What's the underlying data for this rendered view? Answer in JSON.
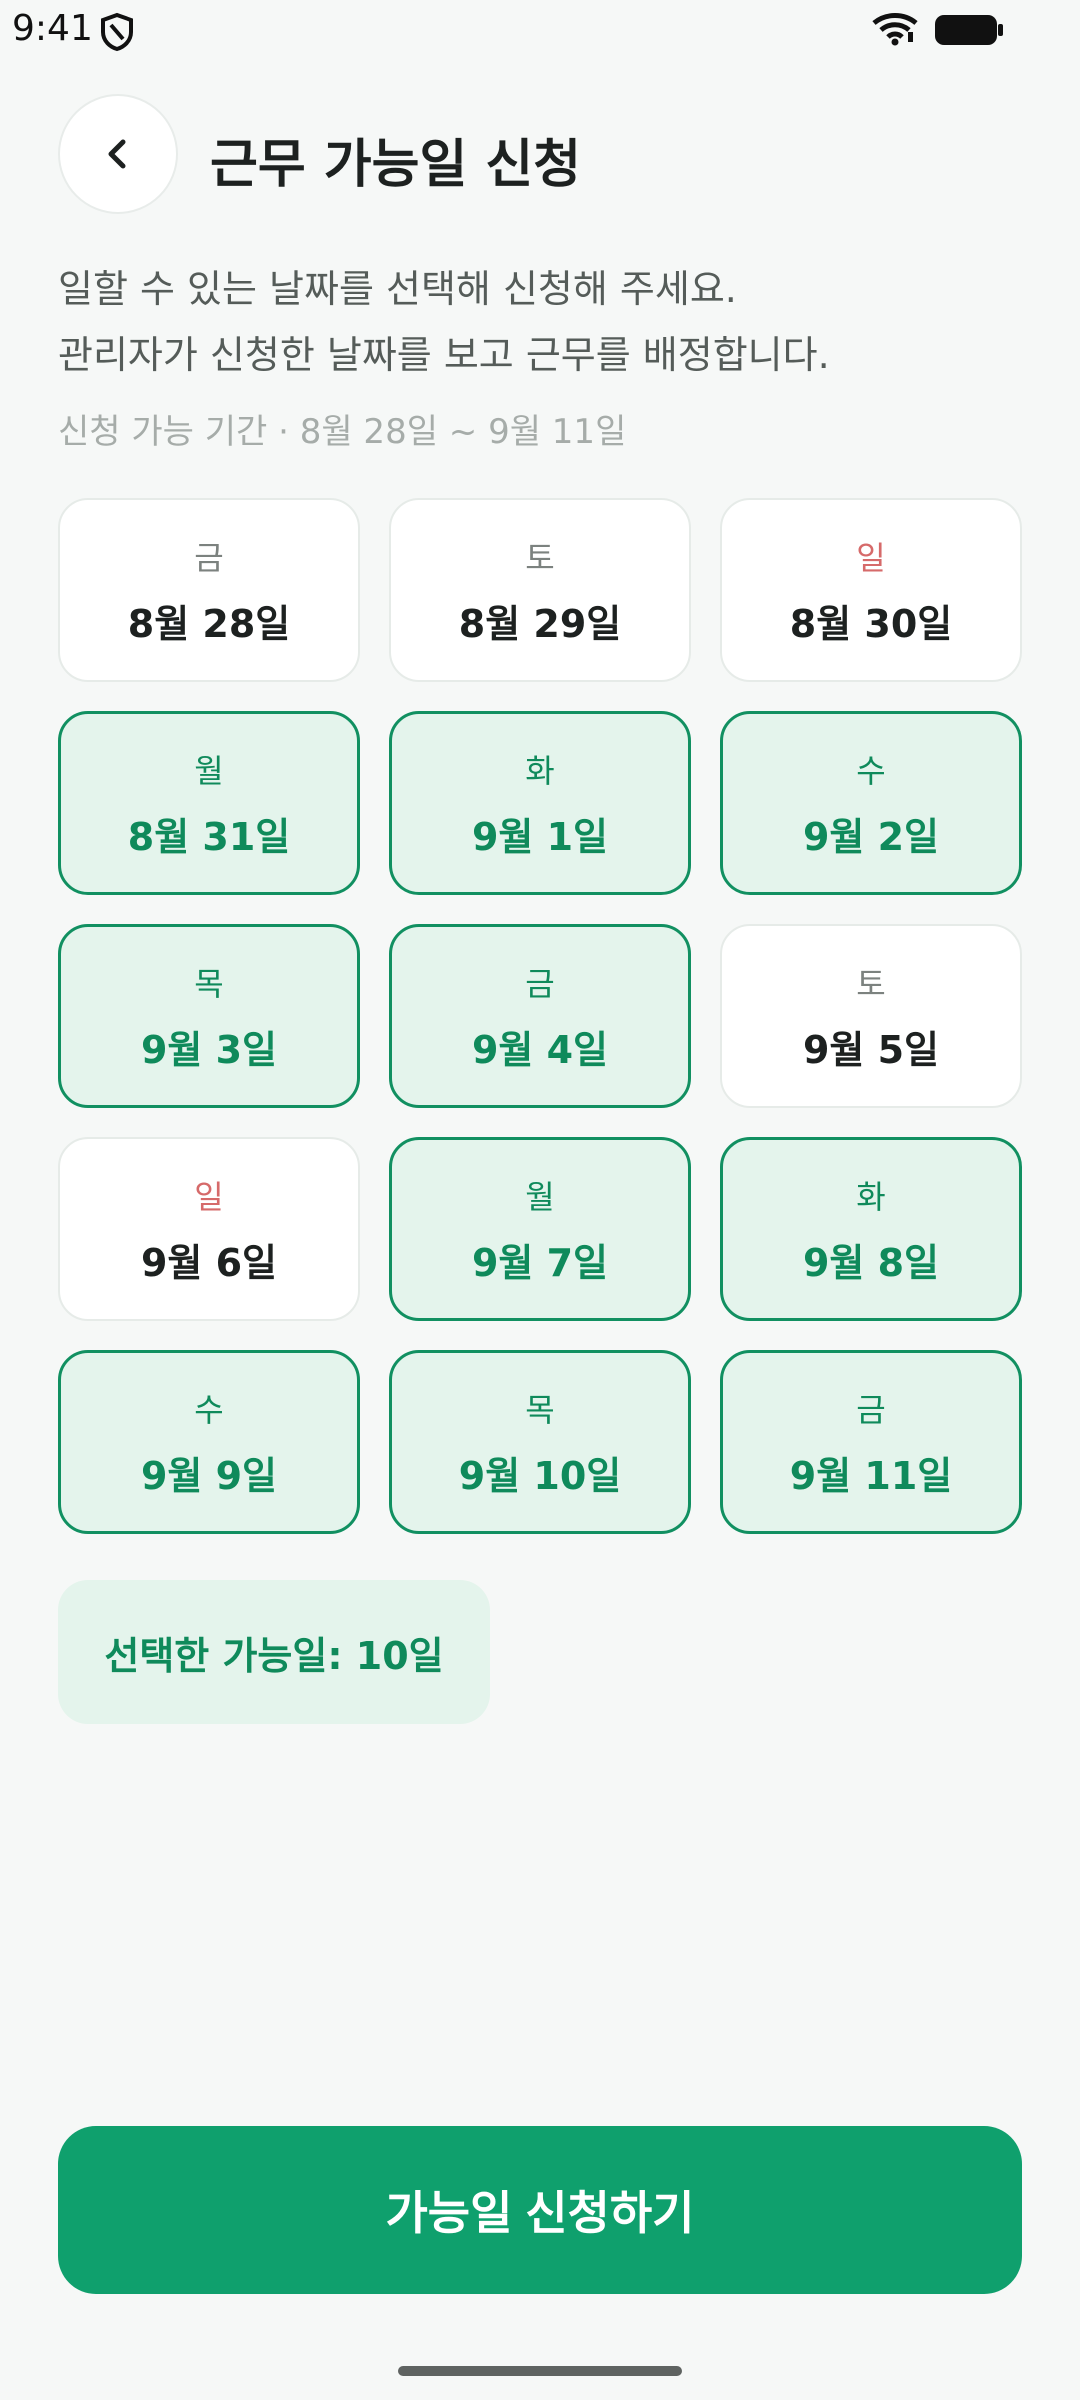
{
  "status_bar": {
    "time": "9:41"
  },
  "header": {
    "title": "근무 가능일 신청"
  },
  "description": {
    "line1": "일할 수 있는 날짜를 선택해 신청해 주세요.",
    "line2": "관리자가 신청한 날짜를 보고 근무를 배정합니다."
  },
  "period_label": "신청 가능 기간 · 8월 28일 ~ 9월 11일",
  "days": [
    {
      "weekday": "금",
      "date": "8월 28일",
      "selected": false,
      "sunday": false
    },
    {
      "weekday": "토",
      "date": "8월 29일",
      "selected": false,
      "sunday": false
    },
    {
      "weekday": "일",
      "date": "8월 30일",
      "selected": false,
      "sunday": true
    },
    {
      "weekday": "월",
      "date": "8월 31일",
      "selected": true,
      "sunday": false
    },
    {
      "weekday": "화",
      "date": "9월 1일",
      "selected": true,
      "sunday": false
    },
    {
      "weekday": "수",
      "date": "9월 2일",
      "selected": true,
      "sunday": false
    },
    {
      "weekday": "목",
      "date": "9월 3일",
      "selected": true,
      "sunday": false
    },
    {
      "weekday": "금",
      "date": "9월 4일",
      "selected": true,
      "sunday": false
    },
    {
      "weekday": "토",
      "date": "9월 5일",
      "selected": false,
      "sunday": false
    },
    {
      "weekday": "일",
      "date": "9월 6일",
      "selected": false,
      "sunday": true
    },
    {
      "weekday": "월",
      "date": "9월 7일",
      "selected": true,
      "sunday": false
    },
    {
      "weekday": "화",
      "date": "9월 8일",
      "selected": true,
      "sunday": false
    },
    {
      "weekday": "수",
      "date": "9월 9일",
      "selected": true,
      "sunday": false
    },
    {
      "weekday": "목",
      "date": "9월 10일",
      "selected": true,
      "sunday": false
    },
    {
      "weekday": "금",
      "date": "9월 11일",
      "selected": true,
      "sunday": false
    }
  ],
  "summary": "선택한 가능일: 10일",
  "submit_label": "가능일 신청하기",
  "colors": {
    "accent": "#0fa06d",
    "selected_bg": "#e4f4ec",
    "sunday": "#d66a6a"
  }
}
